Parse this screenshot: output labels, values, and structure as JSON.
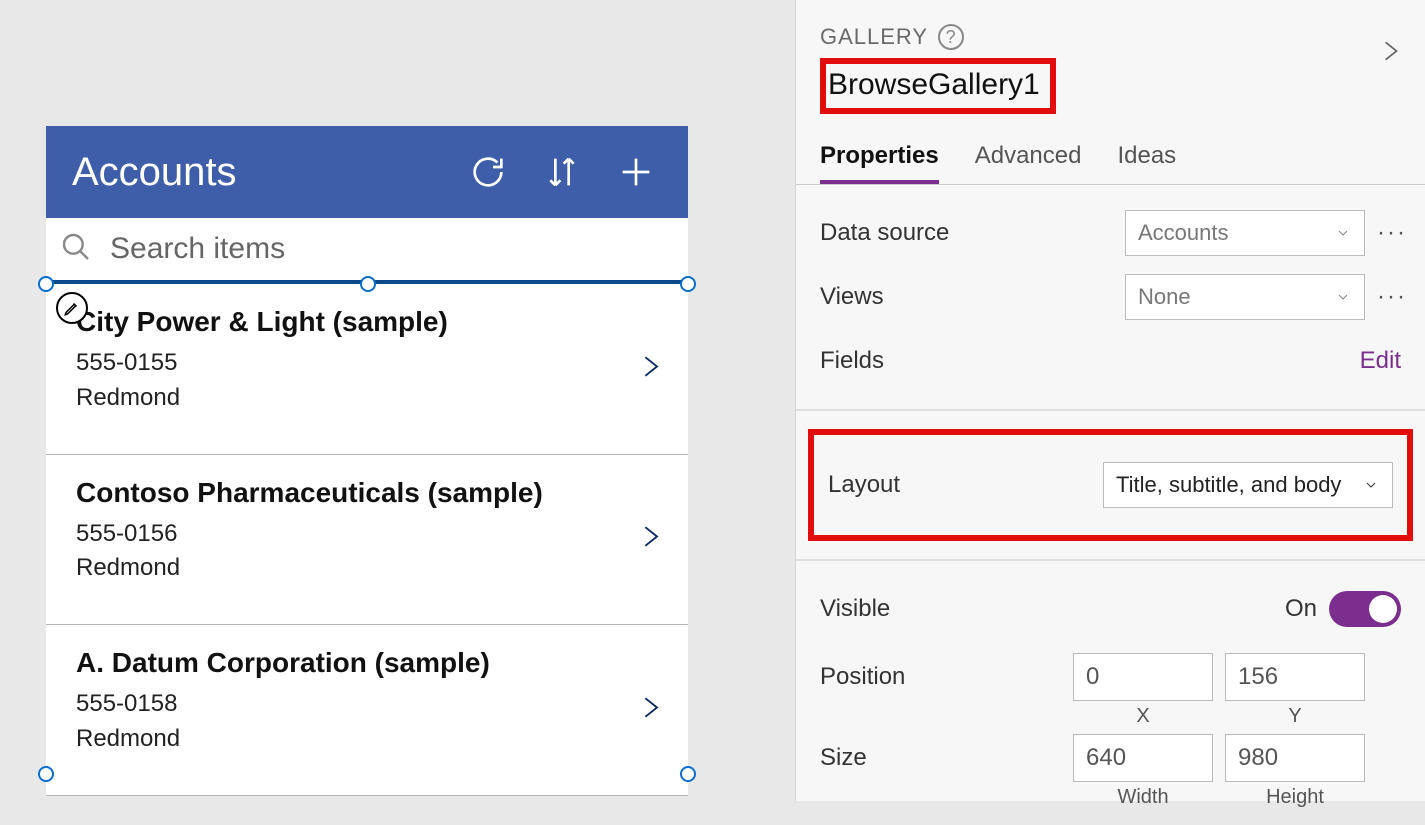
{
  "preview": {
    "title": "Accounts",
    "search_placeholder": "Search items",
    "items": [
      {
        "title": "City Power & Light (sample)",
        "subtitle": "555-0155",
        "body": "Redmond"
      },
      {
        "title": "Contoso Pharmaceuticals (sample)",
        "subtitle": "555-0156",
        "body": "Redmond"
      },
      {
        "title": "A. Datum Corporation (sample)",
        "subtitle": "555-0158",
        "body": "Redmond"
      }
    ]
  },
  "panel": {
    "type_label": "GALLERY",
    "control_name": "BrowseGallery1",
    "tabs": {
      "properties": "Properties",
      "advanced": "Advanced",
      "ideas": "Ideas"
    },
    "props": {
      "data_source_label": "Data source",
      "data_source_value": "Accounts",
      "views_label": "Views",
      "views_value": "None",
      "fields_label": "Fields",
      "fields_edit": "Edit",
      "layout_label": "Layout",
      "layout_value": "Title, subtitle, and body",
      "visible_label": "Visible",
      "visible_value": "On",
      "position_label": "Position",
      "position_x": "0",
      "position_y": "156",
      "position_x_axis": "X",
      "position_y_axis": "Y",
      "size_label": "Size",
      "size_w": "640",
      "size_h": "980",
      "size_w_axis": "Width",
      "size_h_axis": "Height"
    }
  }
}
